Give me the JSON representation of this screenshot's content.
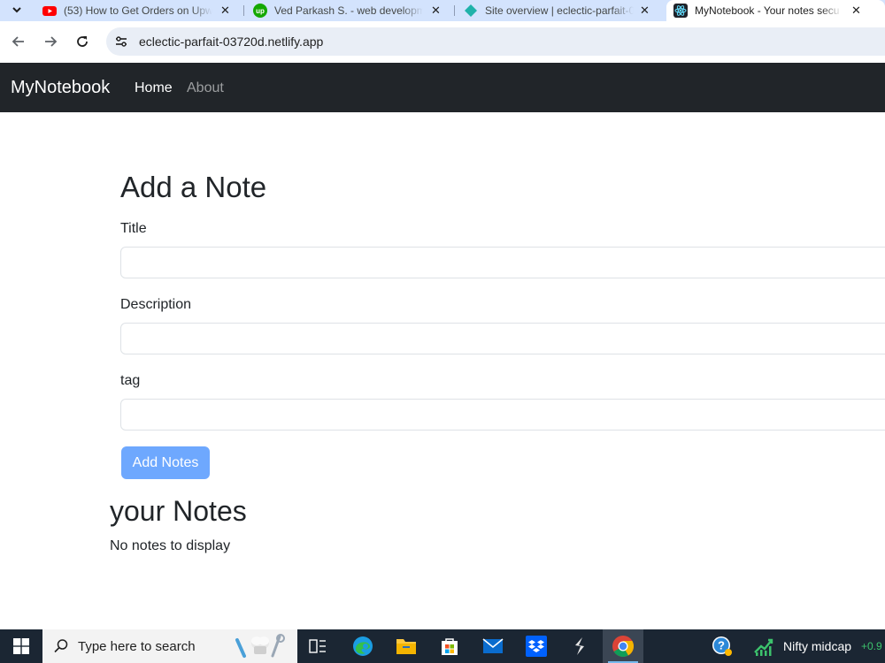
{
  "browser": {
    "tabs": [
      {
        "title": "(53) How to Get Orders on Upw",
        "icon": "youtube-icon"
      },
      {
        "title": "Ved Parkash S. - web developm",
        "icon": "upwork-icon"
      },
      {
        "title": "Site overview | eclectic-parfait-0",
        "icon": "netlify-icon"
      },
      {
        "title": "MyNotebook - Your notes secu",
        "icon": "react-icon",
        "active": true
      }
    ],
    "tab_close_glyph": "✕",
    "tab_list_glyph": "⌄",
    "url": "eclectic-parfait-03720d.netlify.app",
    "back_glyph": "←",
    "forward_glyph": "→",
    "reload_glyph": "↻"
  },
  "navbar": {
    "brand": "MyNotebook",
    "links": [
      "Home",
      "About"
    ]
  },
  "form": {
    "heading": "Add a Note",
    "title_label": "Title",
    "description_label": "Description",
    "tag_label": "tag",
    "title_value": "",
    "description_value": "",
    "tag_value": "",
    "submit_label": "Add Notes",
    "submit_color": "#6ea8fe"
  },
  "notes": {
    "heading": "your Notes",
    "empty_message": "No notes to display"
  },
  "taskbar": {
    "search_placeholder": "Type here to search",
    "ticker_label": "Nifty midcap",
    "ticker_value": "+0.9",
    "ticker_color": "#3cc26c",
    "icons": [
      "windows-start-icon",
      "task-view-icon",
      "edge-icon",
      "file-explorer-icon",
      "microsoft-store-icon",
      "mail-icon",
      "dropbox-icon",
      "sublime-icon",
      "chrome-icon",
      "help-icon",
      "stock-chart-icon"
    ]
  }
}
